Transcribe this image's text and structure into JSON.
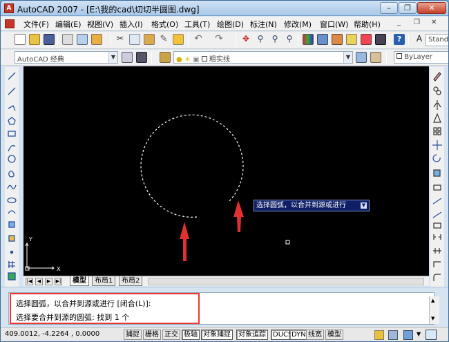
{
  "window": {
    "title": "AutoCAD 2007 - [E:\\我的cad\\切切半圆图.dwg]",
    "app_icon": "autocad-logo-icon",
    "controls": [
      "minimize",
      "restore",
      "close"
    ]
  },
  "menu": {
    "items": [
      "文件(F)",
      "编辑(E)",
      "视图(V)",
      "插入(I)",
      "格式(O)",
      "工具(T)",
      "绘图(D)",
      "标注(N)",
      "修改(M)",
      "窗口(W)",
      "帮助(H)"
    ]
  },
  "standard_toolbar": {
    "style_combo": "Stand"
  },
  "workspace_toolbar": {
    "workspace": "AutoCAD 经典",
    "layer": "粗实线",
    "color": "ByLayer"
  },
  "drawing": {
    "background": "#000000",
    "arc_stroke": "#ffffff",
    "tooltip": "选择圆弧，以合并到源或进行",
    "annotation_color": "#e03030"
  },
  "layout_tabs": {
    "tabs": [
      "模型",
      "布局1",
      "布局2"
    ],
    "active": "模型"
  },
  "command": {
    "line1": "选择圆弧，以合并到源或进行 [闭合(L)]:",
    "line2": "选择要合并到源的圆弧: 找到 1 个",
    "highlight_color": "#e33333"
  },
  "status": {
    "coords": "409.0012, -4.2264 , 0.0000",
    "buttons": [
      "捕捉",
      "栅格",
      "正交",
      "极轴",
      "对象捕捉",
      "对象追踪",
      "DUCS",
      "DYN",
      "线宽",
      "模型"
    ],
    "active": [
      "极轴",
      "对象捕捉",
      "对象追踪",
      "DUCS",
      "DYN"
    ]
  }
}
